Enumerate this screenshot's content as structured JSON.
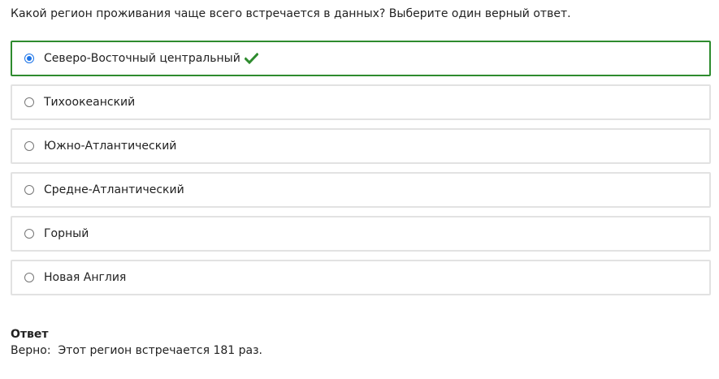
{
  "question": "Какой регион проживания чаще всего встречается в данных? Выберите один верный ответ.",
  "options": [
    {
      "label": "Северо-Восточный центральный",
      "selected": true,
      "correct": true
    },
    {
      "label": "Тихоокеанский",
      "selected": false,
      "correct": false
    },
    {
      "label": "Южно-Атлантический",
      "selected": false,
      "correct": false
    },
    {
      "label": "Средне-Атлантический",
      "selected": false,
      "correct": false
    },
    {
      "label": "Горный",
      "selected": false,
      "correct": false
    },
    {
      "label": "Новая Англия",
      "selected": false,
      "correct": false
    }
  ],
  "feedback": {
    "title": "Ответ",
    "text": "Верно:  Этот регион встречается 181 раз."
  },
  "colors": {
    "correct_border": "#2e8b2e",
    "check_icon": "#2e8b2e",
    "radio_selected": "#1a73e8",
    "option_border": "#e2e2e2"
  },
  "icons": {
    "correct_mark": "check-icon"
  }
}
